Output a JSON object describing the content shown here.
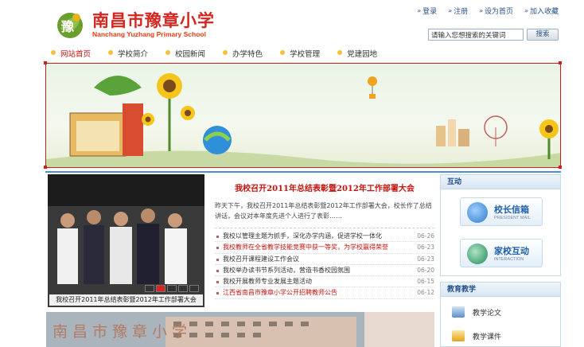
{
  "header": {
    "logo_char": "豫",
    "school_name_cn": "南昌市豫章小学",
    "school_name_en": "Nanchang Yuzhang Primary School",
    "top_links": [
      "登录",
      "注册",
      "设为首页",
      "加入收藏"
    ]
  },
  "search": {
    "placeholder": "请输入您想搜索的关键词",
    "button_label": "搜索"
  },
  "nav": {
    "items": [
      "网站首页",
      "学校简介",
      "校园新闻",
      "办学特色",
      "学校管理",
      "党建园地"
    ],
    "active_index": 0
  },
  "photo": {
    "caption": "我校召开2011年总结表彰暨2012年工作部署大会"
  },
  "news": {
    "headline": "我校召开2011年总结表彰暨2012年工作部署大会",
    "summary": "昨天下午，我校召开2011年总结表彰暨2012年工作部署大会，校长作了总结讲话，会议对本年度先进个人进行了表彰……",
    "items": [
      {
        "title": "我校以管理主题为抓手，深化办学内涵，促进学校一体化",
        "date": "06-26",
        "red": false
      },
      {
        "title": "我校教师在全省教学技能竞赛中获一等奖，为学校赢得荣誉",
        "date": "06-23",
        "red": true
      },
      {
        "title": "我校召开课程建设工作会议",
        "date": "06-23",
        "red": false
      },
      {
        "title": "我校举办读书节系列活动，营造书香校园氛围",
        "date": "06-20",
        "red": false
      },
      {
        "title": "我校开展教师专业发展主题活动",
        "date": "06-15",
        "red": false
      },
      {
        "title": "江西省南昌市豫章小学公开招聘教师公告",
        "date": "06-12",
        "red": true
      }
    ]
  },
  "panels": {
    "interact_title": "互动",
    "principal_mail_cn": "校长信箱",
    "principal_mail_en": "PRESIDENT MAIL",
    "home_school_cn": "家校互动",
    "home_school_en": "INTERACTION",
    "docs_title": "教育教学",
    "doc_items": [
      "教学论文",
      "教学课件"
    ]
  },
  "bottom": {
    "sign_text": "南昌市豫章小学"
  },
  "colors": {
    "brand_red": "#d6251e",
    "link_blue": "#2b4e8c",
    "accent_blue": "#4d8ed4"
  }
}
